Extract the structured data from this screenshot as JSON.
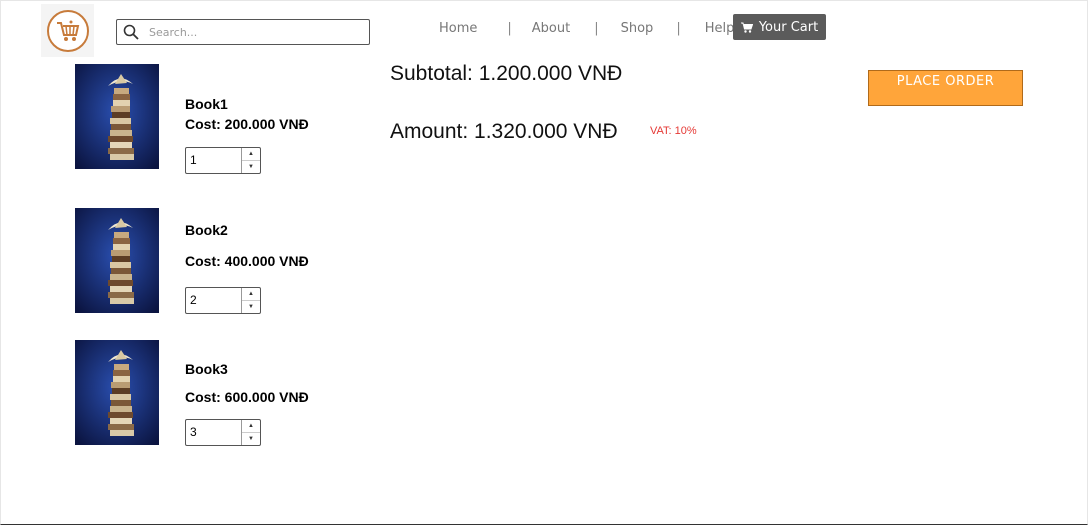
{
  "header": {
    "search_placeholder": "Search...",
    "nav": [
      {
        "label": "Home"
      },
      {
        "label": "About"
      },
      {
        "label": "Shop"
      },
      {
        "label": "Help"
      }
    ],
    "nav_separator": "|",
    "cart_label": "Your Cart"
  },
  "cart": {
    "items": [
      {
        "title": "Book1",
        "cost": "Cost: 200.000 VNĐ",
        "quantity": "1"
      },
      {
        "title": "Book2",
        "cost": "Cost: 400.000 VNĐ",
        "quantity": "2"
      },
      {
        "title": "Book3",
        "cost": "Cost: 600.000 VNĐ",
        "quantity": "3"
      }
    ]
  },
  "summary": {
    "subtotal": "Subtotal: 1.200.000 VNĐ",
    "amount": "Amount: 1.320.000 VNĐ",
    "vat": "VAT: 10%",
    "place_order_label": "PLACE ORDER"
  },
  "colors": {
    "accent": "#ffa53a",
    "cart_button": "#5b5b5b",
    "vat_text": "#e53935",
    "logo_ring": "#c77b3b"
  },
  "icons": {
    "logo": "shopping-cart-logo-icon",
    "search": "search-icon",
    "cart": "cart-icon",
    "book_image": "book-stack-image"
  }
}
